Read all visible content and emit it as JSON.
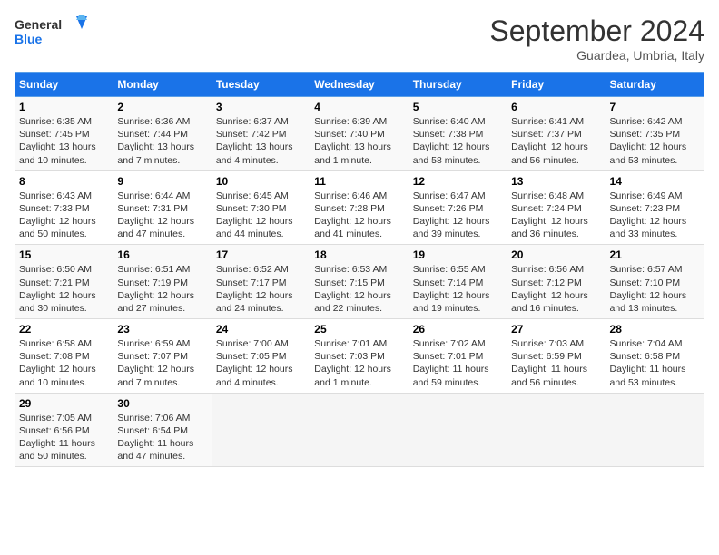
{
  "header": {
    "logo_line1": "General",
    "logo_line2": "Blue",
    "month": "September 2024",
    "location": "Guardea, Umbria, Italy"
  },
  "weekdays": [
    "Sunday",
    "Monday",
    "Tuesday",
    "Wednesday",
    "Thursday",
    "Friday",
    "Saturday"
  ],
  "weeks": [
    [
      {
        "day": "1",
        "info": "Sunrise: 6:35 AM\nSunset: 7:45 PM\nDaylight: 13 hours\nand 10 minutes."
      },
      {
        "day": "2",
        "info": "Sunrise: 6:36 AM\nSunset: 7:44 PM\nDaylight: 13 hours\nand 7 minutes."
      },
      {
        "day": "3",
        "info": "Sunrise: 6:37 AM\nSunset: 7:42 PM\nDaylight: 13 hours\nand 4 minutes."
      },
      {
        "day": "4",
        "info": "Sunrise: 6:39 AM\nSunset: 7:40 PM\nDaylight: 13 hours\nand 1 minute."
      },
      {
        "day": "5",
        "info": "Sunrise: 6:40 AM\nSunset: 7:38 PM\nDaylight: 12 hours\nand 58 minutes."
      },
      {
        "day": "6",
        "info": "Sunrise: 6:41 AM\nSunset: 7:37 PM\nDaylight: 12 hours\nand 56 minutes."
      },
      {
        "day": "7",
        "info": "Sunrise: 6:42 AM\nSunset: 7:35 PM\nDaylight: 12 hours\nand 53 minutes."
      }
    ],
    [
      {
        "day": "8",
        "info": "Sunrise: 6:43 AM\nSunset: 7:33 PM\nDaylight: 12 hours\nand 50 minutes."
      },
      {
        "day": "9",
        "info": "Sunrise: 6:44 AM\nSunset: 7:31 PM\nDaylight: 12 hours\nand 47 minutes."
      },
      {
        "day": "10",
        "info": "Sunrise: 6:45 AM\nSunset: 7:30 PM\nDaylight: 12 hours\nand 44 minutes."
      },
      {
        "day": "11",
        "info": "Sunrise: 6:46 AM\nSunset: 7:28 PM\nDaylight: 12 hours\nand 41 minutes."
      },
      {
        "day": "12",
        "info": "Sunrise: 6:47 AM\nSunset: 7:26 PM\nDaylight: 12 hours\nand 39 minutes."
      },
      {
        "day": "13",
        "info": "Sunrise: 6:48 AM\nSunset: 7:24 PM\nDaylight: 12 hours\nand 36 minutes."
      },
      {
        "day": "14",
        "info": "Sunrise: 6:49 AM\nSunset: 7:23 PM\nDaylight: 12 hours\nand 33 minutes."
      }
    ],
    [
      {
        "day": "15",
        "info": "Sunrise: 6:50 AM\nSunset: 7:21 PM\nDaylight: 12 hours\nand 30 minutes."
      },
      {
        "day": "16",
        "info": "Sunrise: 6:51 AM\nSunset: 7:19 PM\nDaylight: 12 hours\nand 27 minutes."
      },
      {
        "day": "17",
        "info": "Sunrise: 6:52 AM\nSunset: 7:17 PM\nDaylight: 12 hours\nand 24 minutes."
      },
      {
        "day": "18",
        "info": "Sunrise: 6:53 AM\nSunset: 7:15 PM\nDaylight: 12 hours\nand 22 minutes."
      },
      {
        "day": "19",
        "info": "Sunrise: 6:55 AM\nSunset: 7:14 PM\nDaylight: 12 hours\nand 19 minutes."
      },
      {
        "day": "20",
        "info": "Sunrise: 6:56 AM\nSunset: 7:12 PM\nDaylight: 12 hours\nand 16 minutes."
      },
      {
        "day": "21",
        "info": "Sunrise: 6:57 AM\nSunset: 7:10 PM\nDaylight: 12 hours\nand 13 minutes."
      }
    ],
    [
      {
        "day": "22",
        "info": "Sunrise: 6:58 AM\nSunset: 7:08 PM\nDaylight: 12 hours\nand 10 minutes."
      },
      {
        "day": "23",
        "info": "Sunrise: 6:59 AM\nSunset: 7:07 PM\nDaylight: 12 hours\nand 7 minutes."
      },
      {
        "day": "24",
        "info": "Sunrise: 7:00 AM\nSunset: 7:05 PM\nDaylight: 12 hours\nand 4 minutes."
      },
      {
        "day": "25",
        "info": "Sunrise: 7:01 AM\nSunset: 7:03 PM\nDaylight: 12 hours\nand 1 minute."
      },
      {
        "day": "26",
        "info": "Sunrise: 7:02 AM\nSunset: 7:01 PM\nDaylight: 11 hours\nand 59 minutes."
      },
      {
        "day": "27",
        "info": "Sunrise: 7:03 AM\nSunset: 6:59 PM\nDaylight: 11 hours\nand 56 minutes."
      },
      {
        "day": "28",
        "info": "Sunrise: 7:04 AM\nSunset: 6:58 PM\nDaylight: 11 hours\nand 53 minutes."
      }
    ],
    [
      {
        "day": "29",
        "info": "Sunrise: 7:05 AM\nSunset: 6:56 PM\nDaylight: 11 hours\nand 50 minutes."
      },
      {
        "day": "30",
        "info": "Sunrise: 7:06 AM\nSunset: 6:54 PM\nDaylight: 11 hours\nand 47 minutes."
      },
      {
        "day": "",
        "info": ""
      },
      {
        "day": "",
        "info": ""
      },
      {
        "day": "",
        "info": ""
      },
      {
        "day": "",
        "info": ""
      },
      {
        "day": "",
        "info": ""
      }
    ]
  ]
}
